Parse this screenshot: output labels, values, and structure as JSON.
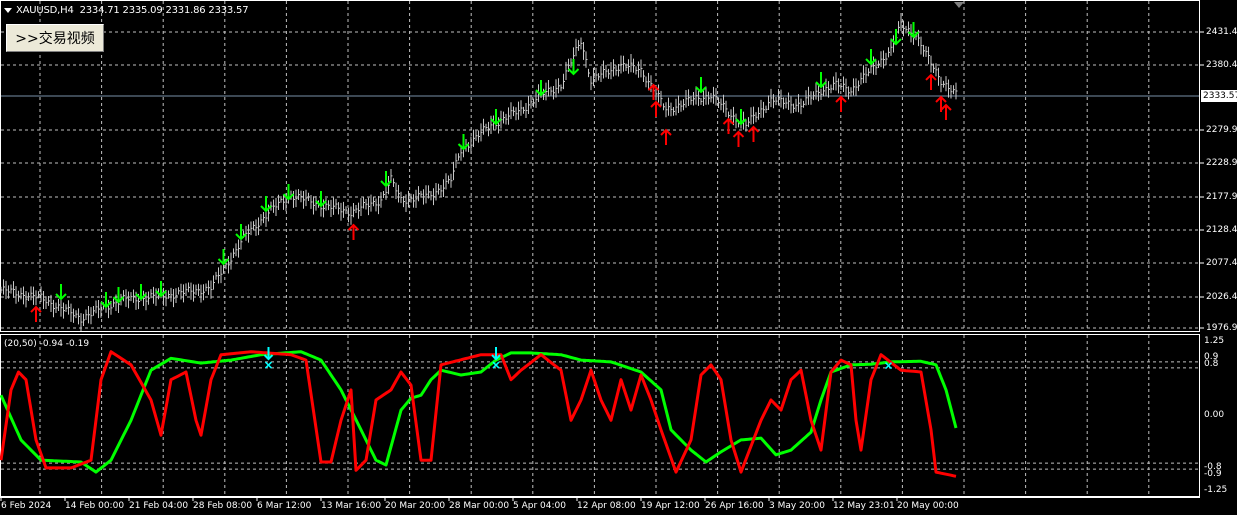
{
  "header": {
    "symbol": "XAUUSD,H4",
    "ohlc": "2334.71 2335.09 2331.86 2333.57"
  },
  "button": {
    "label": ">>交易视频"
  },
  "price_axis": {
    "labels": [
      "2431.40",
      "2380.40",
      "2279.90",
      "2228.90",
      "2177.90",
      "2128.40",
      "2077.40",
      "2026.40",
      "1976.90"
    ],
    "current_price": "2333.57"
  },
  "oscillator": {
    "header": "(20,50) -0.94 -0.19",
    "axis_labels": [
      "1.25",
      "0.9",
      "0.8",
      "0.00",
      "-0.8",
      "-0.9",
      "-1.25"
    ]
  },
  "time_axis": [
    "6 Feb 2024",
    "14 Feb 00:00",
    "21 Feb 04:00",
    "28 Feb 08:00",
    "6 Mar 12:00",
    "13 Mar 16:00",
    "20 Mar 20:00",
    "28 Mar 00:00",
    "5 Apr 04:00",
    "12 Apr 08:00",
    "19 Apr 12:00",
    "26 Apr 16:00",
    "3 May 20:00",
    "12 May 23:01",
    "20 May 00:00"
  ],
  "colors": {
    "background": "#000000",
    "bars": "#c8c8c8",
    "buy_arrow": "#00ff00",
    "sell_arrow": "#ff0000",
    "osc_fast": "#ff0000",
    "osc_slow": "#00ff00",
    "cross": "#00ffff",
    "grid": "#c0c0c0"
  },
  "chart_data": {
    "type": "line",
    "price_range": [
      1976.9,
      2431.4
    ],
    "close_path": [
      [
        0,
        2035.2
      ],
      [
        16,
        2022.9
      ],
      [
        32,
        1992.2
      ],
      [
        48,
        2019.9
      ],
      [
        64,
        2026.0
      ],
      [
        84,
        2038.3
      ],
      [
        90,
        2073.6
      ],
      [
        98,
        2119.7
      ],
      [
        108,
        2158.1
      ],
      [
        116,
        2181.1
      ],
      [
        128,
        2165.8
      ],
      [
        140,
        2155.0
      ],
      [
        152,
        2173.4
      ],
      [
        156,
        2204.1
      ],
      [
        160,
        2173.4
      ],
      [
        172,
        2181.1
      ],
      [
        180,
        2204.1
      ],
      [
        184,
        2250.2
      ],
      [
        196,
        2288.6
      ],
      [
        208,
        2311.6
      ],
      [
        216,
        2334.7
      ],
      [
        224,
        2350.0
      ],
      [
        232,
        2419.1
      ],
      [
        236,
        2357.7
      ],
      [
        248,
        2380.7
      ],
      [
        256,
        2373.1
      ],
      [
        260,
        2350.0
      ],
      [
        266,
        2311.6
      ],
      [
        276,
        2327.0
      ],
      [
        284,
        2334.7
      ],
      [
        292,
        2304.0
      ],
      [
        298,
        2288.6
      ],
      [
        308,
        2327.0
      ],
      [
        320,
        2319.3
      ],
      [
        328,
        2342.3
      ],
      [
        334,
        2350.0
      ],
      [
        340,
        2342.3
      ],
      [
        348,
        2373.1
      ],
      [
        356,
        2403.8
      ],
      [
        360,
        2442.2
      ],
      [
        366,
        2426.8
      ],
      [
        370,
        2396.1
      ],
      [
        376,
        2357.7
      ],
      [
        382,
        2334.7
      ]
    ],
    "buy_signals": [
      [
        24,
        2019.9
      ],
      [
        42,
        2007.6
      ],
      [
        47,
        2015.3
      ],
      [
        56,
        2019.9
      ],
      [
        64,
        2024.5
      ],
      [
        89,
        2073.6
      ],
      [
        96,
        2112.0
      ],
      [
        106,
        2155.0
      ],
      [
        115,
        2173.4
      ],
      [
        128,
        2162.7
      ],
      [
        154,
        2193.4
      ],
      [
        185,
        2250.2
      ],
      [
        198,
        2288.6
      ],
      [
        216,
        2333.1
      ],
      [
        229,
        2365.4
      ],
      [
        280,
        2337.7
      ],
      [
        296,
        2288.6
      ],
      [
        328,
        2345.4
      ],
      [
        348,
        2380.7
      ],
      [
        358,
        2411.4
      ],
      [
        365,
        2422.2
      ]
    ],
    "sell_signals": [
      [
        14,
        2004.5
      ],
      [
        141,
        2130.4
      ],
      [
        261,
        2345.4
      ],
      [
        262,
        2319.3
      ],
      [
        266,
        2276.3
      ],
      [
        291,
        2293.2
      ],
      [
        295,
        2273.3
      ],
      [
        301,
        2281.0
      ],
      [
        336,
        2327.0
      ],
      [
        372,
        2360.8
      ],
      [
        376,
        2327.0
      ],
      [
        378,
        2314.7
      ]
    ],
    "osc_range": [
      -1.25,
      1.25
    ],
    "osc_levels": [
      0.9,
      0.8,
      -0.8,
      -0.9
    ],
    "osc_fast": [
      [
        0,
        -0.75
      ],
      [
        4,
        0.43
      ],
      [
        7,
        0.73
      ],
      [
        10,
        0.6
      ],
      [
        14,
        -0.41
      ],
      [
        18,
        -0.88
      ],
      [
        28,
        -0.88
      ],
      [
        36,
        -0.75
      ],
      [
        40,
        0.6
      ],
      [
        44,
        1.07
      ],
      [
        52,
        0.85
      ],
      [
        60,
        0.26
      ],
      [
        64,
        -0.33
      ],
      [
        68,
        0.6
      ],
      [
        74,
        0.73
      ],
      [
        78,
        -0.08
      ],
      [
        80,
        -0.33
      ],
      [
        84,
        0.6
      ],
      [
        88,
        1.02
      ],
      [
        100,
        1.07
      ],
      [
        116,
        1.02
      ],
      [
        122,
        0.93
      ],
      [
        128,
        -0.78
      ],
      [
        132,
        -0.78
      ],
      [
        136,
        -0.08
      ],
      [
        140,
        0.43
      ],
      [
        142,
        -0.92
      ],
      [
        146,
        -0.75
      ],
      [
        150,
        0.26
      ],
      [
        156,
        0.43
      ],
      [
        160,
        0.73
      ],
      [
        164,
        0.51
      ],
      [
        168,
        -0.75
      ],
      [
        172,
        -0.75
      ],
      [
        176,
        0.85
      ],
      [
        192,
        1.02
      ],
      [
        200,
        1.02
      ],
      [
        204,
        0.6
      ],
      [
        208,
        0.76
      ],
      [
        216,
        1.02
      ],
      [
        224,
        0.76
      ],
      [
        228,
        -0.08
      ],
      [
        232,
        0.26
      ],
      [
        236,
        0.76
      ],
      [
        240,
        0.26
      ],
      [
        244,
        -0.08
      ],
      [
        248,
        0.6
      ],
      [
        252,
        0.09
      ],
      [
        256,
        0.68
      ],
      [
        260,
        0.26
      ],
      [
        264,
        -0.24
      ],
      [
        270,
        -0.95
      ],
      [
        276,
        -0.41
      ],
      [
        280,
        0.68
      ],
      [
        284,
        0.85
      ],
      [
        288,
        0.6
      ],
      [
        292,
        -0.41
      ],
      [
        296,
        -0.95
      ],
      [
        304,
        -0.08
      ],
      [
        308,
        0.26
      ],
      [
        312,
        0.09
      ],
      [
        316,
        0.6
      ],
      [
        320,
        0.76
      ],
      [
        324,
        -0.08
      ],
      [
        328,
        -0.58
      ],
      [
        332,
        0.73
      ],
      [
        336,
        0.93
      ],
      [
        340,
        0.85
      ],
      [
        342,
        -0.08
      ],
      [
        344,
        -0.58
      ],
      [
        348,
        0.6
      ],
      [
        352,
        1.02
      ],
      [
        360,
        0.76
      ],
      [
        368,
        0.73
      ],
      [
        372,
        -0.24
      ],
      [
        374,
        -0.95
      ],
      [
        382,
        -1.02
      ]
    ],
    "osc_slow": [
      [
        0,
        0.34
      ],
      [
        8,
        -0.41
      ],
      [
        16,
        -0.75
      ],
      [
        32,
        -0.78
      ],
      [
        38,
        -0.95
      ],
      [
        44,
        -0.75
      ],
      [
        52,
        -0.08
      ],
      [
        60,
        0.76
      ],
      [
        68,
        0.96
      ],
      [
        80,
        0.88
      ],
      [
        92,
        0.93
      ],
      [
        104,
        1.02
      ],
      [
        120,
        1.07
      ],
      [
        128,
        0.93
      ],
      [
        136,
        0.43
      ],
      [
        144,
        -0.24
      ],
      [
        150,
        -0.75
      ],
      [
        154,
        -0.83
      ],
      [
        160,
        0.09
      ],
      [
        164,
        0.29
      ],
      [
        168,
        0.34
      ],
      [
        172,
        0.6
      ],
      [
        176,
        0.76
      ],
      [
        184,
        0.68
      ],
      [
        192,
        0.73
      ],
      [
        198,
        0.93
      ],
      [
        204,
        1.05
      ],
      [
        212,
        1.05
      ],
      [
        224,
        1.02
      ],
      [
        232,
        0.93
      ],
      [
        244,
        0.9
      ],
      [
        256,
        0.73
      ],
      [
        264,
        0.43
      ],
      [
        268,
        -0.24
      ],
      [
        276,
        -0.58
      ],
      [
        282,
        -0.78
      ],
      [
        288,
        -0.61
      ],
      [
        296,
        -0.41
      ],
      [
        304,
        -0.38
      ],
      [
        310,
        -0.66
      ],
      [
        316,
        -0.58
      ],
      [
        324,
        -0.28
      ],
      [
        328,
        0.26
      ],
      [
        332,
        0.73
      ],
      [
        340,
        0.85
      ],
      [
        348,
        0.86
      ],
      [
        356,
        0.9
      ],
      [
        368,
        0.91
      ],
      [
        374,
        0.85
      ],
      [
        378,
        0.43
      ],
      [
        382,
        -0.21
      ]
    ],
    "crosses": [
      [
        107,
        0.88
      ],
      [
        198,
        0.88
      ],
      [
        355,
        0.87
      ]
    ]
  }
}
